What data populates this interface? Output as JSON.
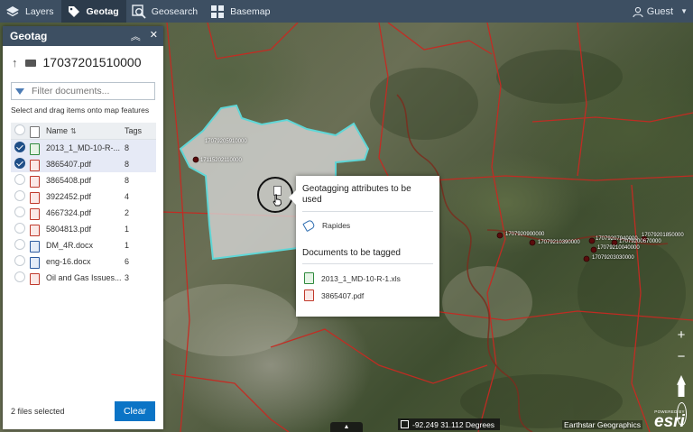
{
  "toolbar": {
    "items": [
      {
        "label": "Layers",
        "icon": "layers-icon"
      },
      {
        "label": "Geotag",
        "icon": "tag-icon",
        "active": true
      },
      {
        "label": "Geosearch",
        "icon": "geosearch-icon"
      },
      {
        "label": "Basemap",
        "icon": "basemap-grid-icon"
      }
    ],
    "user": "Guest"
  },
  "panel": {
    "title": "Geotag",
    "folder": "17037201510000",
    "filter_placeholder": "Filter documents...",
    "hint": "Select and drag items onto map features",
    "columns": {
      "name": "Name",
      "tags": "Tags"
    },
    "documents": [
      {
        "name": "2013_1_MD-10-R-...",
        "type": "xls",
        "tags": "8",
        "selected": true
      },
      {
        "name": "3865407.pdf",
        "type": "pdf",
        "tags": "8",
        "selected": true
      },
      {
        "name": "3865408.pdf",
        "type": "pdf",
        "tags": "8",
        "selected": false
      },
      {
        "name": "3922452.pdf",
        "type": "pdf",
        "tags": "4",
        "selected": false
      },
      {
        "name": "4667324.pdf",
        "type": "pdf",
        "tags": "2",
        "selected": false
      },
      {
        "name": "5804813.pdf",
        "type": "pdf",
        "tags": "1",
        "selected": false
      },
      {
        "name": "DM_4R.docx",
        "type": "doc",
        "tags": "1",
        "selected": false
      },
      {
        "name": "eng-16.docx",
        "type": "doc",
        "tags": "6",
        "selected": false
      },
      {
        "name": "Oil and Gas Issues...",
        "type": "pdf",
        "tags": "3",
        "selected": false
      }
    ],
    "selected_count": "2 files selected",
    "clear_label": "Clear"
  },
  "popup": {
    "heading": "Geotagging attributes to be used",
    "attribute": "Rapides",
    "docs_heading": "Documents to be tagged",
    "docs": [
      {
        "name": "2013_1_MD-10-R-1.xls",
        "type": "xls"
      },
      {
        "name": "3865407.pdf",
        "type": "pdf"
      }
    ]
  },
  "map": {
    "labels": [
      "17079205910000",
      "17115202110000",
      "1707920900000",
      "17079210390000",
      "17079207940000",
      "17079210040000",
      "17079203030000",
      "17079201850000",
      "17079200670000"
    ],
    "coordinates": "-92.249 31.112 Degrees",
    "attribution": "Earthstar Geographics",
    "powered_by": "POWERED BY",
    "logo_text": "esri"
  }
}
